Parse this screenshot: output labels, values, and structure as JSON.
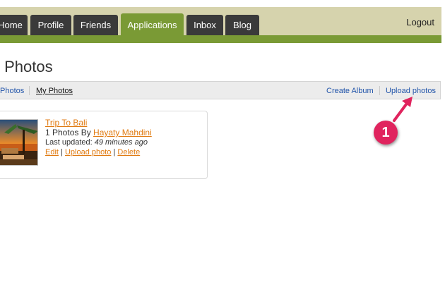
{
  "nav": {
    "tabs": [
      {
        "label": "Home"
      },
      {
        "label": "Profile"
      },
      {
        "label": "Friends"
      },
      {
        "label": "Applications",
        "active": true
      },
      {
        "label": "Inbox"
      },
      {
        "label": "Blog"
      }
    ],
    "logout_label": "Logout"
  },
  "page": {
    "title": "y Photos"
  },
  "subnav": {
    "left": [
      "Photos",
      "My Photos"
    ],
    "right": [
      "Create Album",
      "Upload photos"
    ]
  },
  "album": {
    "title": "Trip To Bali",
    "count_prefix": "1 Photos By ",
    "owner": "Hayaty Mahdini",
    "updated_prefix": "Last updated: ",
    "updated_value": "49 minutes ago",
    "actions": [
      "Edit",
      "Upload photo",
      "Delete"
    ],
    "action_separator": "|"
  },
  "annotation": {
    "step": "1"
  },
  "colors": {
    "nav_bg": "#d6d3ad",
    "accent_green": "#7a9a35",
    "tab_dark": "#3a3a3a",
    "link_blue": "#2255aa",
    "link_orange": "#e07a10",
    "badge_pink": "#e0245e"
  }
}
